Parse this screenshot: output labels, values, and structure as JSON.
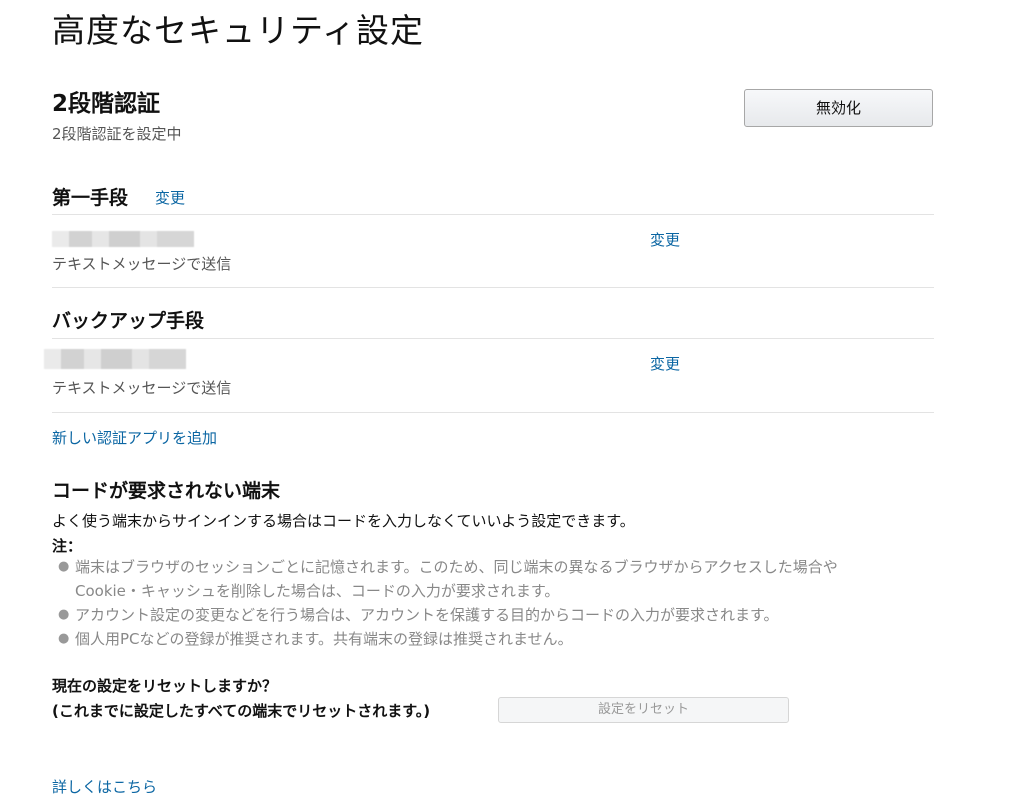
{
  "page": {
    "title": "高度なセキュリティ設定"
  },
  "two_step": {
    "title": "2段階認証",
    "status": "2段階認証を設定中",
    "disable_button": "無効化"
  },
  "primary_method": {
    "title": "第一手段",
    "change_link": "変更",
    "item": {
      "detail": "テキストメッセージで送信",
      "change_link": "変更"
    }
  },
  "backup_method": {
    "title": "バックアップ手段",
    "item": {
      "detail": "テキストメッセージで送信",
      "change_link": "変更"
    }
  },
  "add_auth_app_link": "新しい認証アプリを追加",
  "trusted_devices": {
    "title": "コードが要求されない端末",
    "description": "よく使う端末からサインインする場合はコードを入力しなくていいよう設定できます。",
    "note_label": "注：",
    "notes": [
      "端末はブラウザのセッションごとに記憶されます。このため、同じ端末の異なるブラウザからアクセスした場合や",
      "Cookie・キャッシュを削除した場合は、コードの入力が要求されます。",
      "アカウント設定の変更などを行う場合は、アカウントを保護する目的からコードの入力が要求されます。",
      "個人用PCなどの登録が推奨されます。共有端末の登録は推奨されません。"
    ]
  },
  "reset": {
    "question_line1": "現在の設定をリセットしますか？",
    "question_line2": "(これまでに設定したすべての端末でリセットされます。)",
    "button": "設定をリセット"
  },
  "learn_more_link": "詳しくはこちら",
  "icons": {
    "bullet": "bullet-icon"
  }
}
